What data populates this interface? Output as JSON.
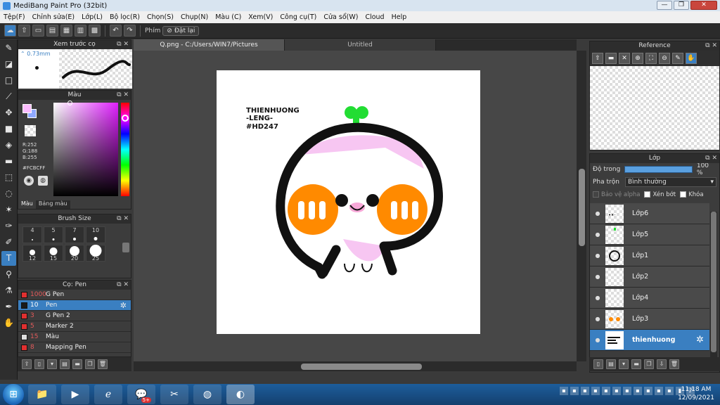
{
  "window": {
    "title": "MediBang Paint Pro (32bit)",
    "min": "—",
    "max": "❐",
    "close": "✕"
  },
  "menu": [
    "Tệp(F)",
    "Chỉnh sửa(E)",
    "Lớp(L)",
    "Bộ lọc(R)",
    "Chọn(S)",
    "Chụp(N)",
    "Màu (C)",
    "Xem(V)",
    "Công cụ(T)",
    "Cửa sổ(W)",
    "Cloud",
    "Help"
  ],
  "toolbar": {
    "hotkey_label": "Phím",
    "reset_label": "Đặt lại"
  },
  "brush_preview": {
    "title": "Xem trước cọ",
    "size": "0.73mm"
  },
  "color": {
    "title": "Màu",
    "r": "R:252",
    "g": "G:188",
    "b": "B:255",
    "hex": "#FCBCFF",
    "tab_color": "Màu",
    "tab_palette": "Bảng màu",
    "fg": "#fcbcff",
    "bg": "#8fa8ff"
  },
  "brush_size": {
    "title": "Brush Size",
    "sizes": [
      "4",
      "5",
      "7",
      "10",
      "12",
      "15",
      "20",
      "25"
    ]
  },
  "pens": {
    "title": "Cọ: Pen",
    "items": [
      {
        "size": "1000",
        "name": "G Pen",
        "color": "#e03030"
      },
      {
        "size": "10",
        "name": "Pen",
        "color": "#1a1a1a"
      },
      {
        "size": "3",
        "name": "G Pen 2",
        "color": "#e03030"
      },
      {
        "size": "5",
        "name": "Marker 2",
        "color": "#e03030"
      },
      {
        "size": "15",
        "name": "Màu",
        "color": "#dddddd"
      },
      {
        "size": "8",
        "name": "Mapping Pen",
        "color": "#e03030"
      }
    ]
  },
  "tabs": [
    "Q.png - C:/Users/WIN7/Pictures",
    "Untitled"
  ],
  "artwork": {
    "text1": "THIENHUONG",
    "text2": "-LENG-",
    "text3": "#HD247"
  },
  "reference": {
    "title": "Reference"
  },
  "layers": {
    "title": "Lớp",
    "opacity_label": "Độ trong",
    "opacity_value": "100 %",
    "blend_label": "Pha trộn",
    "blend_value": "Bình thường",
    "protect_alpha": "Bảo vệ alpha",
    "clipping": "Xén bớt",
    "lock": "Khóa",
    "items": [
      {
        "name": "Lớp6"
      },
      {
        "name": "Lớp5"
      },
      {
        "name": "Lớp1"
      },
      {
        "name": "Lớp2"
      },
      {
        "name": "Lớp4"
      },
      {
        "name": "Lớp3"
      },
      {
        "name": "thienhuong"
      }
    ]
  },
  "taskbar": {
    "time": "11:18 AM",
    "date": "12/09/2021"
  }
}
